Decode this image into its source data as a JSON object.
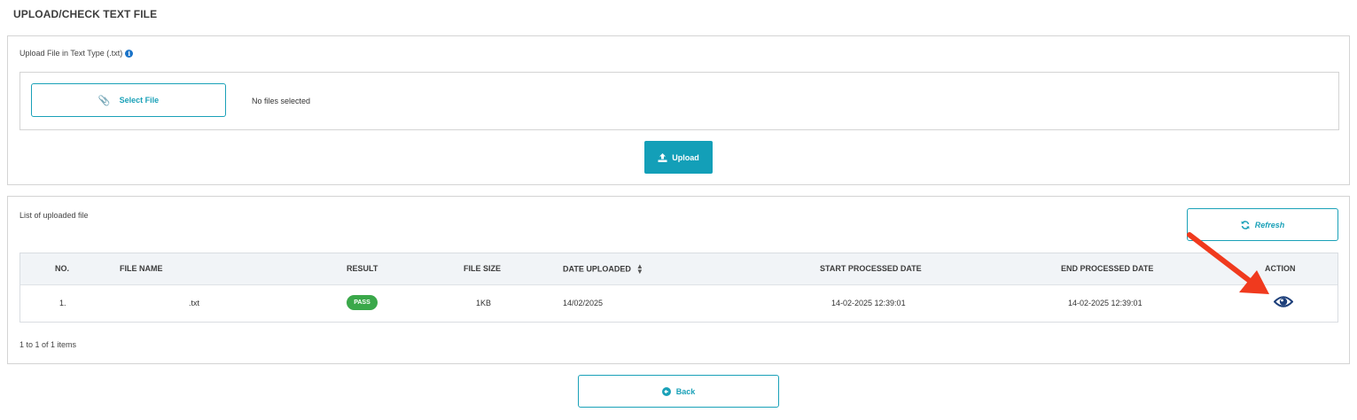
{
  "page": {
    "title": "UPLOAD/CHECK TEXT FILE"
  },
  "upload": {
    "label": "Upload File in Text Type (.txt)",
    "select_file_label": "Select File",
    "no_files_text": "No files selected",
    "upload_button_label": "Upload"
  },
  "list": {
    "label": "List of uploaded file",
    "refresh_label": "Refresh",
    "columns": [
      "NO.",
      "FILE NAME",
      "RESULT",
      "FILE SIZE",
      "DATE UPLOADED",
      "START PROCESSED DATE",
      "END PROCESSED DATE",
      "ACTION"
    ],
    "rows": [
      {
        "no": "1.",
        "file_name": ".txt",
        "result": "PASS",
        "file_size": "1KB",
        "date_uploaded": "14/02/2025",
        "start_processed": "14-02-2025 12:39:01",
        "end_processed": "14-02-2025 12:39:01",
        "action_icon": "eye-icon"
      }
    ],
    "pagination_info": "1 to 1 of 1 items"
  },
  "back_label": "Back",
  "colors": {
    "accent": "#1aa1b8",
    "pass": "#3aa84a",
    "annotation_arrow": "#f03a1e",
    "eye": "#1d3f7a"
  }
}
